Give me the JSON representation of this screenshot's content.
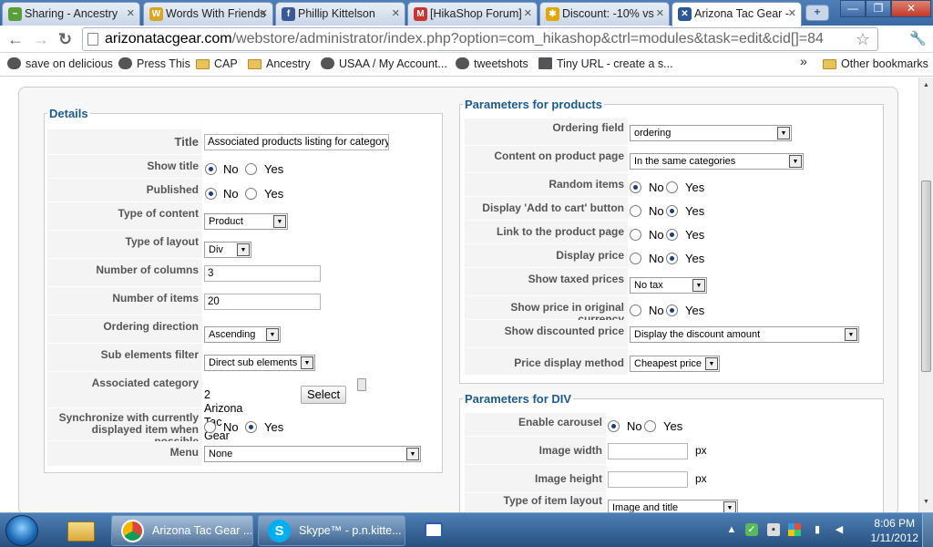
{
  "tabs": [
    {
      "label": "Sharing - Ancestry",
      "fav": "#5a9e3a",
      "glyph": "~"
    },
    {
      "label": "Words With Friends",
      "fav": "#d8a620",
      "glyph": "W"
    },
    {
      "label": "Phillip Kittelson",
      "fav": "#3b5998",
      "glyph": "f"
    },
    {
      "label": "[HikaShop Forum]",
      "fav": "#c33",
      "glyph": "M"
    },
    {
      "label": "Discount: -10% vs",
      "fav": "#e0a800",
      "glyph": "✱"
    },
    {
      "label": "Arizona Tac Gear -",
      "fav": "#2b5797",
      "glyph": "✕",
      "active": true
    }
  ],
  "window": {
    "minimize": "—",
    "restore": "❐",
    "close": "✕",
    "newtab": "+"
  },
  "toolbar": {
    "back": "←",
    "forward": "→",
    "reload": "↻",
    "star": "☆",
    "menu": "🔧",
    "url_host": "arizonatacgear.com",
    "url_path": "/webstore/administrator/index.php?option=com_hikashop&ctrl=modules&task=edit&cid[]=84"
  },
  "bookmarks": [
    {
      "label": "save on delicious",
      "kind": "icon"
    },
    {
      "label": "Press This",
      "kind": "icon"
    },
    {
      "label": "CAP",
      "kind": "folder"
    },
    {
      "label": "Ancestry",
      "kind": "folder"
    },
    {
      "label": "USAA / My Account...",
      "kind": "icon"
    },
    {
      "label": "tweetshots",
      "kind": "icon"
    },
    {
      "label": "Tiny URL - create a s...",
      "kind": "icon"
    }
  ],
  "bookmarks_overflow": "»",
  "other_bookmarks": "Other bookmarks",
  "details": {
    "legend": "Details",
    "title_label": "Title",
    "title_value": "Associated products listing for category I",
    "show_title_label": "Show title",
    "published_label": "Published",
    "type_content_label": "Type of content",
    "type_content_value": "Product",
    "type_layout_label": "Type of layout",
    "type_layout_value": "Div",
    "num_columns_label": "Number of columns",
    "num_columns_value": "3",
    "num_items_label": "Number of items",
    "num_items_value": "20",
    "ordering_dir_label": "Ordering direction",
    "ordering_dir_value": "Ascending",
    "sub_filter_label": "Sub elements filter",
    "sub_filter_value": "Direct sub elements",
    "assoc_cat_label": "Associated category",
    "assoc_cat_value": "2 Arizona Tac Gear",
    "select_button": "Select",
    "sync_label_1": "Synchronize with currently",
    "sync_label_2": "displayed item when possible",
    "menu_label": "Menu",
    "menu_value": "None"
  },
  "radio": {
    "no": "No",
    "yes": "Yes"
  },
  "products": {
    "legend": "Parameters for products",
    "ordering_field_label": "Ordering field",
    "ordering_field_value": "ordering",
    "content_page_label": "Content on product page",
    "content_page_value": "In the same categories",
    "random_label": "Random items",
    "add_to_cart_label": "Display 'Add to cart' button",
    "link_product_label": "Link to the product page",
    "display_price_label": "Display price",
    "taxed_label": "Show taxed prices",
    "taxed_value": "No tax",
    "orig_currency_label": "Show price in original currency",
    "discounted_label": "Show discounted price",
    "discounted_value": "Display the discount amount",
    "price_method_label": "Price display method",
    "price_method_value": "Cheapest price"
  },
  "div": {
    "legend": "Parameters for DIV",
    "carousel_label": "Enable carousel",
    "img_width_label": "Image width",
    "img_height_label": "Image height",
    "item_layout_label": "Type of item layout",
    "item_layout_value": "Image and title",
    "px": "px"
  },
  "taskbar": {
    "task1": "Arizona Tac Gear ...",
    "task2": "Skype™ - p.n.kitte...",
    "time": "8:06 PM",
    "date": "1/11/2012"
  }
}
